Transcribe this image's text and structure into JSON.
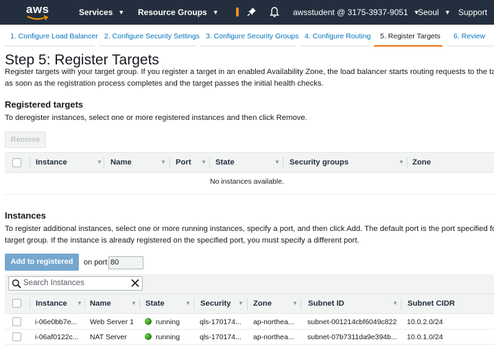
{
  "topnav": {
    "logo_text": "aws",
    "services": "Services",
    "resource_groups": "Resource Groups",
    "account": "awsstudent @ 3175-3937-9051",
    "region": "Seoul",
    "support": "Support"
  },
  "wizard": {
    "tabs": [
      {
        "label": "1. Configure Load Balancer"
      },
      {
        "label": "2. Configure Security Settings"
      },
      {
        "label": "3. Configure Security Groups"
      },
      {
        "label": "4. Configure Routing"
      },
      {
        "label": "5. Register Targets",
        "active": true
      },
      {
        "label": "6. Review"
      }
    ]
  },
  "page": {
    "title": "Step 5: Register Targets",
    "description_line1": "Register targets with your target group. If you register a target in an enabled Availability Zone, the load balancer starts routing requests to the targets",
    "description_line2": "as soon as the registration process completes and the target passes the initial health checks."
  },
  "registered": {
    "heading": "Registered targets",
    "description": "To deregister instances, select one or more registered instances and then click Remove.",
    "remove_label": "Remove",
    "columns": [
      "Instance",
      "Name",
      "Port",
      "State",
      "Security groups",
      "Zone"
    ],
    "empty_message": "No instances available."
  },
  "instances": {
    "heading": "Instances",
    "description_line1": "To register additional instances, select one or more running instances, specify a port, and then click Add. The default port is the port specified for the",
    "description_line2": "target group. If the instance is already registered on the specified port, you must specify a different port.",
    "add_label": "Add to registered",
    "on_port_label": "on port",
    "port_value": "80",
    "search_placeholder": "Search Instances",
    "columns": [
      "Instance",
      "Name",
      "State",
      "Security",
      "Zone",
      "Subnet ID",
      "Subnet CIDR"
    ],
    "rows": [
      {
        "instance": "i-06e0bb7e...",
        "name": "Web Server 1",
        "state": "running",
        "security": "qls-170174...",
        "zone": "ap-northea...",
        "subnet_id": "subnet-001214cbf6049c822",
        "subnet_cidr": "10.0.2.0/24"
      },
      {
        "instance": "i-06af0122c...",
        "name": "NAT Server",
        "state": "running",
        "security": "qls-170174...",
        "zone": "ap-northea...",
        "subnet_id": "subnet-07b7311da9e394b...",
        "subnet_cidr": "10.0.1.0/24"
      }
    ]
  },
  "colors": {
    "nav_bg": "#232f3e",
    "accent": "#ec7211",
    "link": "#0073bb",
    "running": "#1d8102"
  }
}
